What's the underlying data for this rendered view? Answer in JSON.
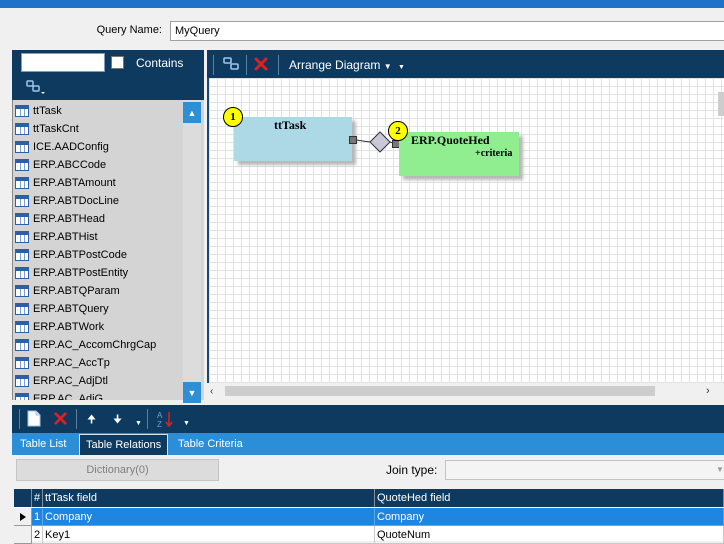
{
  "query": {
    "label": "Query Name:",
    "value": "MyQuery"
  },
  "left_panel": {
    "search_value": "",
    "contains_label": "Contains",
    "contains_checked": false,
    "items": [
      "ttTask",
      "ttTaskCnt",
      "ICE.AADConfig",
      "ERP.ABCCode",
      "ERP.ABTAmount",
      "ERP.ABTDocLine",
      "ERP.ABTHead",
      "ERP.ABTHist",
      "ERP.ABTPostCode",
      "ERP.ABTPostEntity",
      "ERP.ABTQParam",
      "ERP.ABTQuery",
      "ERP.ABTWork",
      "ERP.AC_AccomChrgCap",
      "ERP.AC_AccTp",
      "ERP.AC_AdjDtl",
      "ERP.AC_AdjG"
    ]
  },
  "diagram": {
    "arrange_label": "Arrange Diagram",
    "nodes": [
      {
        "badge": "1",
        "title": "ttTask",
        "criteria": "",
        "color": "#add8e6"
      },
      {
        "badge": "2",
        "title": "ERP.QuoteHed",
        "criteria": "+criteria",
        "color": "#90ee90"
      }
    ]
  },
  "tabs": [
    {
      "label": "Table List",
      "active": false
    },
    {
      "label": "Table Relations",
      "active": true
    },
    {
      "label": "Table Criteria",
      "active": false
    }
  ],
  "relations": {
    "dictionary_label": "Dictionary(0)",
    "join_label": "Join type:",
    "join_value": "",
    "columns": [
      "#",
      "ttTask field",
      "QuoteHed field"
    ],
    "rows": [
      {
        "num": "1",
        "left": "Company",
        "right": "Company",
        "selected": true
      },
      {
        "num": "2",
        "left": "Key1",
        "right": "QuoteNum",
        "selected": false
      }
    ]
  },
  "colors": {
    "toolbar": "#0f3a5f",
    "tabbar": "#2a8fd8",
    "accent": "#1e86e0",
    "delete": "#e02020"
  }
}
